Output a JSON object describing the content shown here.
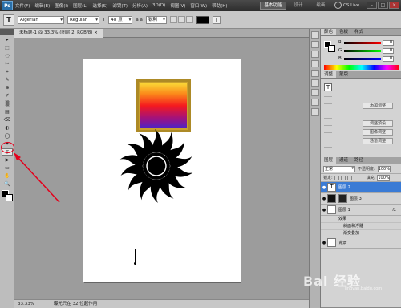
{
  "menubar": {
    "logo": "Ps",
    "items": [
      "文件(F)",
      "编辑(E)",
      "图像(I)",
      "图层(L)",
      "选择(S)",
      "滤镜(T)",
      "分析(A)",
      "3D(D)",
      "视图(V)",
      "窗口(W)",
      "帮助(H)"
    ],
    "workspace_active": "基本功能",
    "workspace_2": "设计",
    "workspace_3": "绘画",
    "cslive": "CS Live",
    "min": "–",
    "max": "□",
    "close": "×"
  },
  "options": {
    "tool_icon": "T",
    "font_family": "Algerian",
    "font_style": "Regular",
    "size_icon": "T",
    "font_size": "48 点",
    "aa_icon": "a a",
    "antialias": "锐利",
    "text_color": "#000000",
    "warp_icon": "T"
  },
  "tools": [
    "▸",
    "⬚",
    "◌",
    "✂",
    "⌗",
    "✎",
    "⊕",
    "✐",
    "▒",
    "▤",
    "⌫",
    "◐",
    "◯",
    "✦",
    "T",
    "▶",
    "▭",
    "✋",
    "🔍"
  ],
  "selected_tool_index": 14,
  "document": {
    "tab": "未标题-1 @ 33.3% (图层 2, RGB/8) ×",
    "gradient_colors": [
      "#f9e13a",
      "#fb8a1a",
      "#f5191f",
      "#a3127b",
      "#3c27d4"
    ],
    "border_color": "#ad8a26"
  },
  "status": {
    "zoom": "33.33%",
    "info": "曝光只在 32 位起作用"
  },
  "color_panel": {
    "tabs": [
      "颜色",
      "色板",
      "样式"
    ],
    "r_label": "R",
    "r_value": "0",
    "g_label": "G",
    "g_value": "0",
    "b_label": "B",
    "b_value": "0"
  },
  "adj_panel": {
    "tabs": [
      "调整",
      "蒙版"
    ],
    "icon": "T",
    "btn1": "添加调整",
    "btn2": "调整预设",
    "btn3": "图像调整",
    "btn4": "通道调整"
  },
  "layers_panel": {
    "tabs": [
      "图层",
      "通道",
      "路径"
    ],
    "blend": "正常",
    "opacity_label": "不透明度:",
    "opacity": "100%",
    "lock_label": "锁定:",
    "fill_label": "填充:",
    "fill": "100%",
    "layers": [
      {
        "name": "图层 2",
        "thumb": "T"
      },
      {
        "name": "图层 3",
        "thumb": ""
      },
      {
        "name": "图层 1",
        "thumb": ""
      },
      {
        "name": "背景",
        "thumb": ""
      }
    ],
    "effects_label": "效果",
    "effect1": "斜面和浮雕",
    "effect2": "渐变叠加",
    "fx": "fx"
  },
  "watermark": "Bai 经验",
  "watermark_sub": "jingyan.baidu.com"
}
